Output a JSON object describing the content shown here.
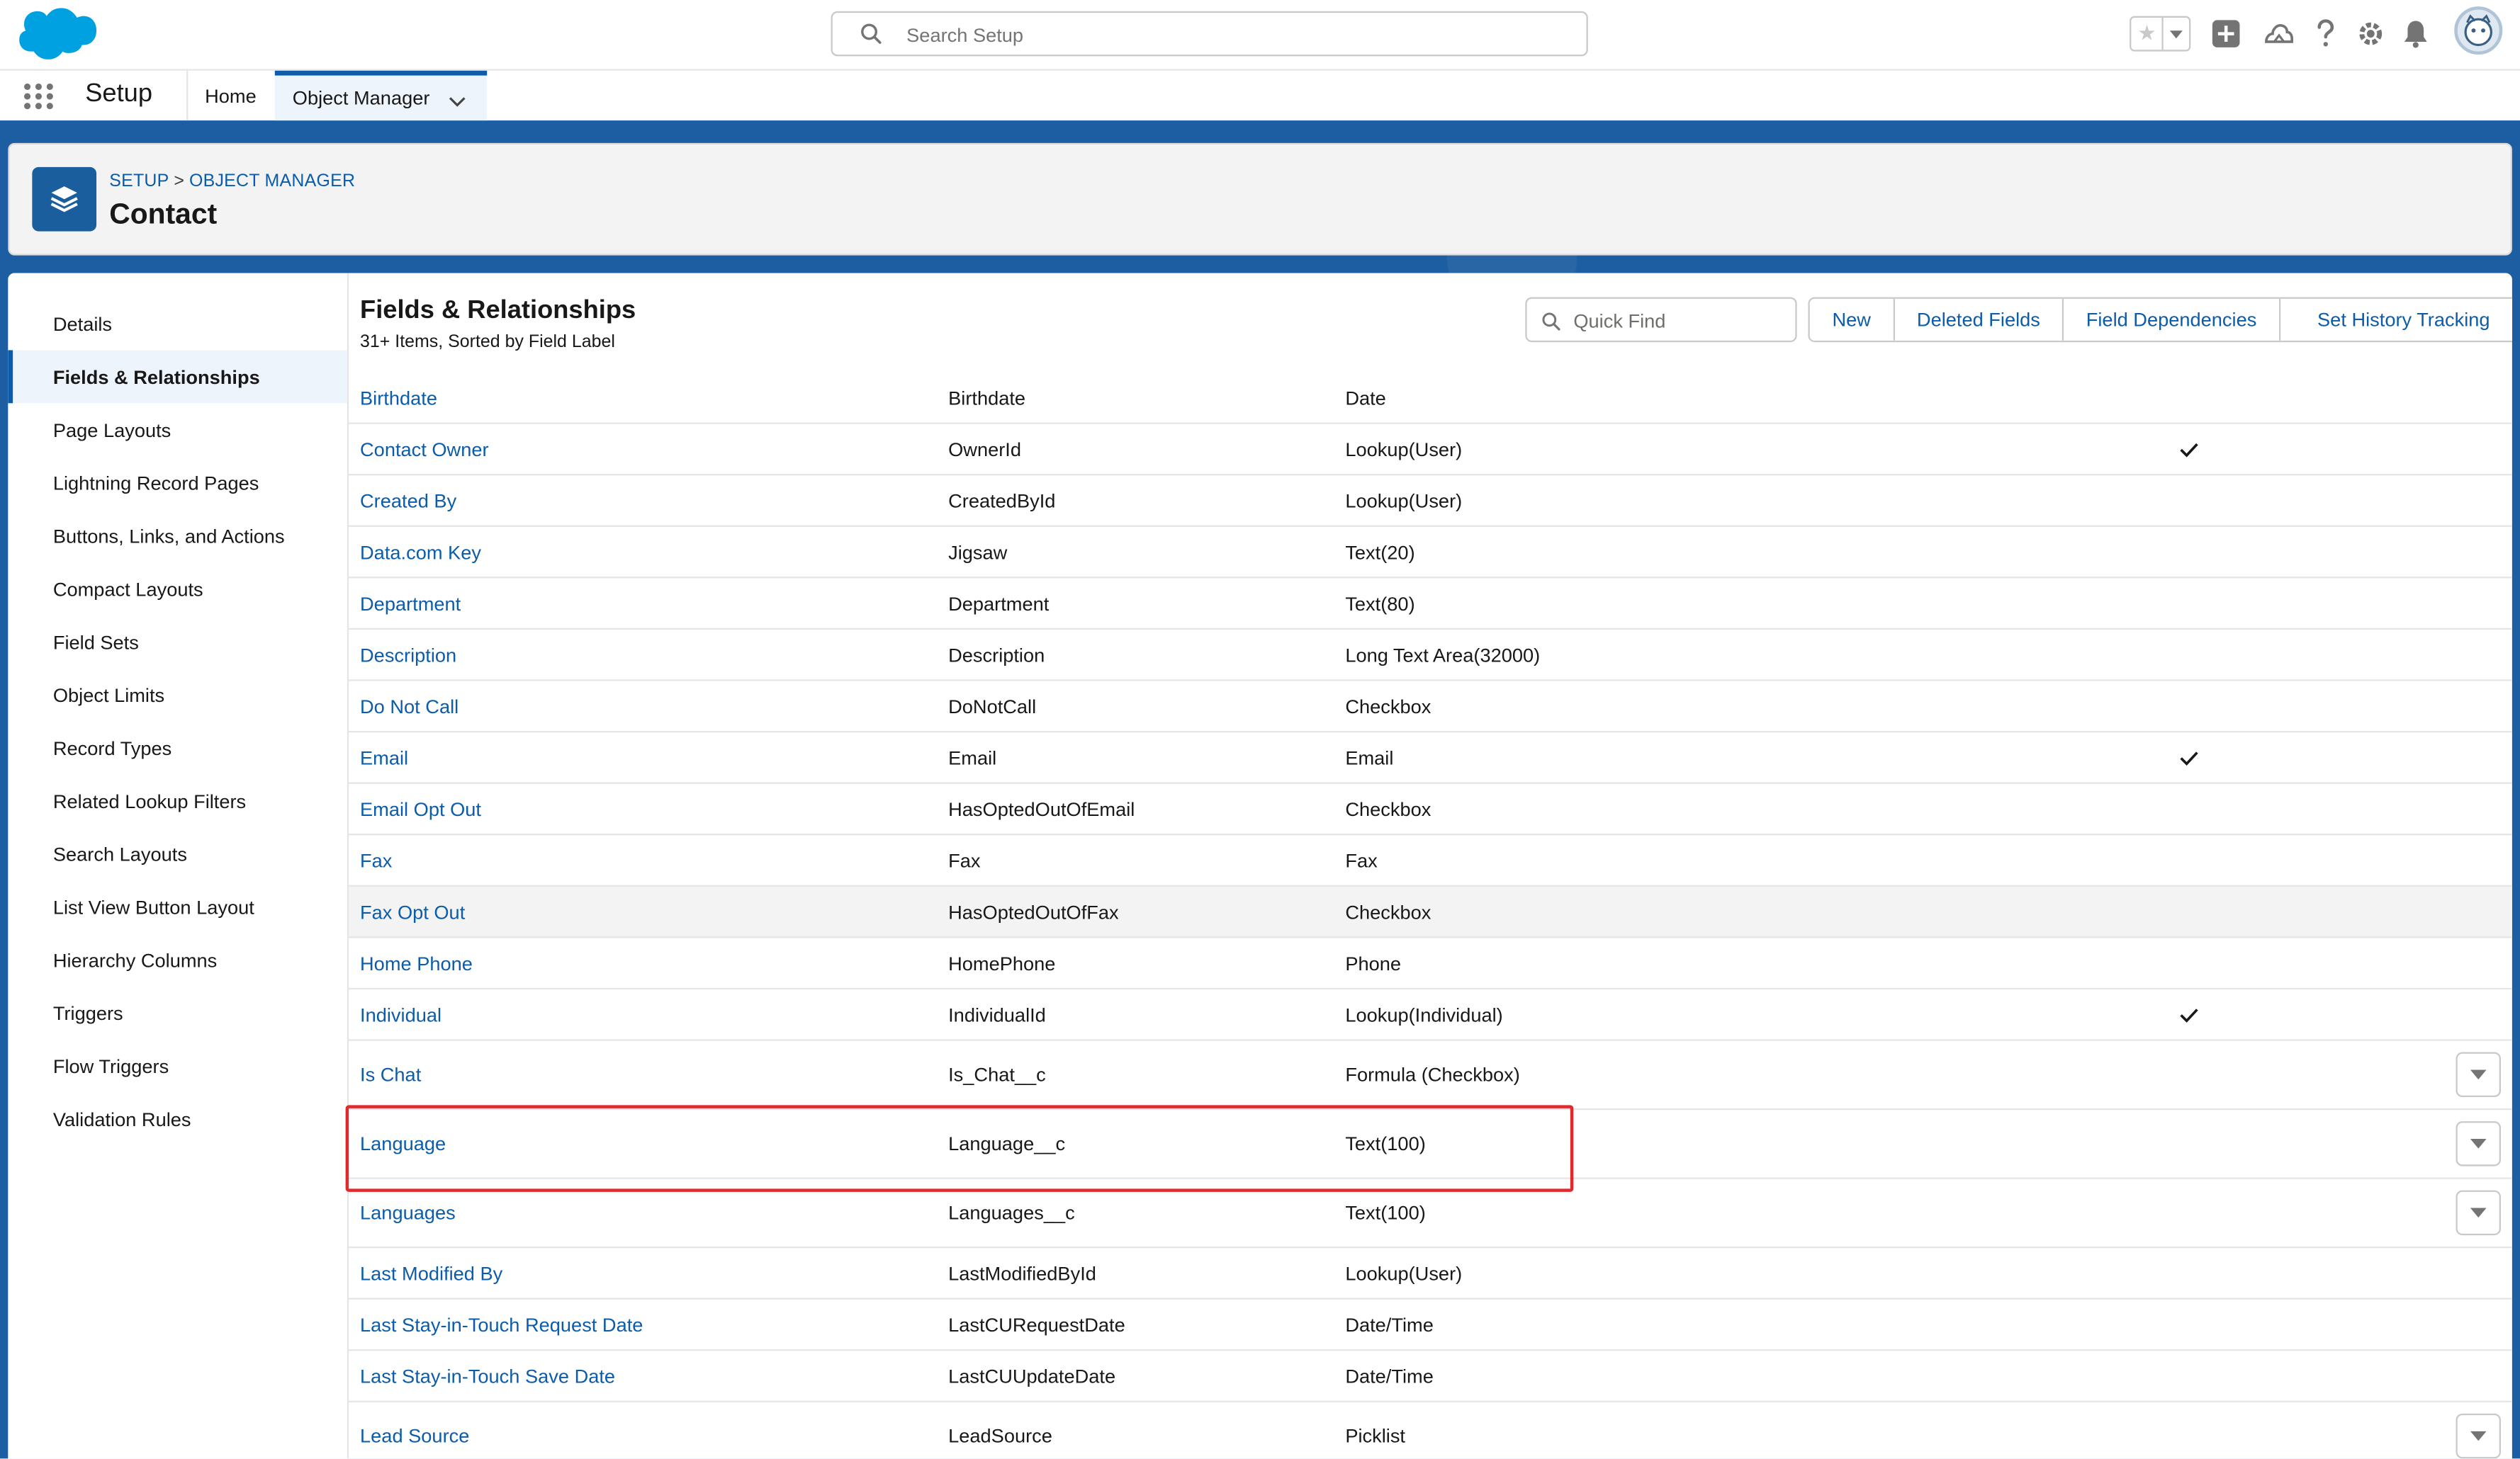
{
  "header": {
    "search_placeholder": "Search Setup",
    "logo_icon": "salesforce-cloud-icon",
    "utility_icons": [
      "favorites-star-icon",
      "add-icon",
      "trailhead-icon",
      "help-icon",
      "gear-icon",
      "bell-icon",
      "avatar"
    ]
  },
  "nav": {
    "app_name": "Setup",
    "tabs": [
      {
        "label": "Home"
      },
      {
        "label": "Object Manager"
      }
    ]
  },
  "object_header": {
    "breadcrumb_root": "SETUP",
    "breadcrumb_sep": ">",
    "breadcrumb_current": "OBJECT MANAGER",
    "title": "Contact",
    "icon": "layers-icon"
  },
  "sidebar": {
    "items": [
      {
        "label": "Details"
      },
      {
        "label": "Fields & Relationships"
      },
      {
        "label": "Page Layouts"
      },
      {
        "label": "Lightning Record Pages"
      },
      {
        "label": "Buttons, Links, and Actions"
      },
      {
        "label": "Compact Layouts"
      },
      {
        "label": "Field Sets"
      },
      {
        "label": "Object Limits"
      },
      {
        "label": "Record Types"
      },
      {
        "label": "Related Lookup Filters"
      },
      {
        "label": "Search Layouts"
      },
      {
        "label": "List View Button Layout"
      },
      {
        "label": "Hierarchy Columns"
      },
      {
        "label": "Triggers"
      },
      {
        "label": "Flow Triggers"
      },
      {
        "label": "Validation Rules"
      }
    ]
  },
  "main": {
    "title": "Fields & Relationships",
    "subtitle": "31+ Items, Sorted by Field Label",
    "quick_find_placeholder": "Quick Find",
    "buttons": [
      "New",
      "Deleted Fields",
      "Field Dependencies",
      "Set History Tracking"
    ],
    "rows": [
      {
        "label": "Birthdate",
        "name": "Birthdate",
        "type": "Date",
        "indexed": false,
        "menu": false
      },
      {
        "label": "Contact Owner",
        "name": "OwnerId",
        "type": "Lookup(User)",
        "indexed": true,
        "menu": false
      },
      {
        "label": "Created By",
        "name": "CreatedById",
        "type": "Lookup(User)",
        "indexed": false,
        "menu": false
      },
      {
        "label": "Data.com Key",
        "name": "Jigsaw",
        "type": "Text(20)",
        "indexed": false,
        "menu": false
      },
      {
        "label": "Department",
        "name": "Department",
        "type": "Text(80)",
        "indexed": false,
        "menu": false
      },
      {
        "label": "Description",
        "name": "Description",
        "type": "Long Text Area(32000)",
        "indexed": false,
        "menu": false
      },
      {
        "label": "Do Not Call",
        "name": "DoNotCall",
        "type": "Checkbox",
        "indexed": false,
        "menu": false
      },
      {
        "label": "Email",
        "name": "Email",
        "type": "Email",
        "indexed": true,
        "menu": false
      },
      {
        "label": "Email Opt Out",
        "name": "HasOptedOutOfEmail",
        "type": "Checkbox",
        "indexed": false,
        "menu": false
      },
      {
        "label": "Fax",
        "name": "Fax",
        "type": "Fax",
        "indexed": false,
        "menu": false
      },
      {
        "label": "Fax Opt Out",
        "name": "HasOptedOutOfFax",
        "type": "Checkbox",
        "indexed": false,
        "menu": false
      },
      {
        "label": "Home Phone",
        "name": "HomePhone",
        "type": "Phone",
        "indexed": false,
        "menu": false
      },
      {
        "label": "Individual",
        "name": "IndividualId",
        "type": "Lookup(Individual)",
        "indexed": true,
        "menu": false
      },
      {
        "label": "Is Chat",
        "name": "Is_Chat__c",
        "type": "Formula (Checkbox)",
        "indexed": false,
        "menu": true
      },
      {
        "label": "Language",
        "name": "Language__c",
        "type": "Text(100)",
        "indexed": false,
        "menu": true
      },
      {
        "label": "Languages",
        "name": "Languages__c",
        "type": "Text(100)",
        "indexed": false,
        "menu": true
      },
      {
        "label": "Last Modified By",
        "name": "LastModifiedById",
        "type": "Lookup(User)",
        "indexed": false,
        "menu": false
      },
      {
        "label": "Last Stay-in-Touch Request Date",
        "name": "LastCURequestDate",
        "type": "Date/Time",
        "indexed": false,
        "menu": false
      },
      {
        "label": "Last Stay-in-Touch Save Date",
        "name": "LastCUUpdateDate",
        "type": "Date/Time",
        "indexed": false,
        "menu": false
      },
      {
        "label": "Lead Source",
        "name": "LeadSource",
        "type": "Picklist",
        "indexed": false,
        "menu": true
      }
    ]
  },
  "colors": {
    "brand_blue": "#0b5cab",
    "band_blue": "#1c5ea1",
    "highlight_red": "#e0292c"
  }
}
